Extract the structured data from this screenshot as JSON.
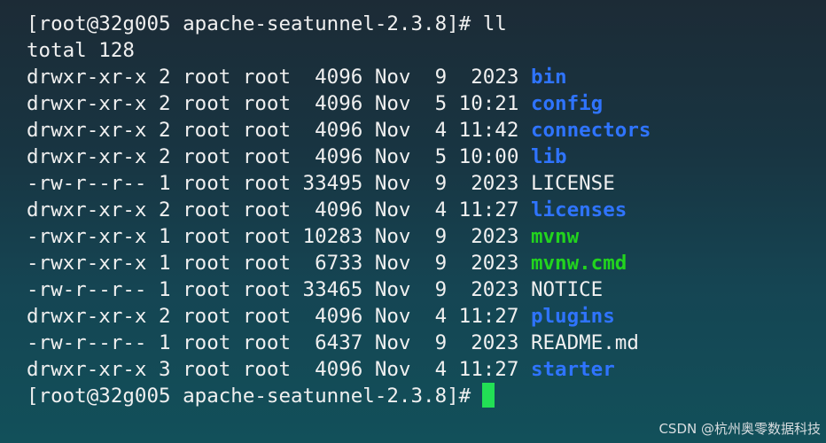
{
  "prompt": "[root@32g005 apache-seatunnel-2.3.8]#",
  "command": "ll",
  "total_line": "total 128",
  "entries": [
    {
      "meta": "drwxr-xr-x 2 root root  4096 Nov  9  2023",
      "name": "bin",
      "kind": "dir"
    },
    {
      "meta": "drwxr-xr-x 2 root root  4096 Nov  5 10:21",
      "name": "config",
      "kind": "dir"
    },
    {
      "meta": "drwxr-xr-x 2 root root  4096 Nov  4 11:42",
      "name": "connectors",
      "kind": "dir"
    },
    {
      "meta": "drwxr-xr-x 2 root root  4096 Nov  5 10:00",
      "name": "lib",
      "kind": "dir"
    },
    {
      "meta": "-rw-r--r-- 1 root root 33495 Nov  9  2023",
      "name": "LICENSE",
      "kind": "file"
    },
    {
      "meta": "drwxr-xr-x 2 root root  4096 Nov  4 11:27",
      "name": "licenses",
      "kind": "dir"
    },
    {
      "meta": "-rwxr-xr-x 1 root root 10283 Nov  9  2023",
      "name": "mvnw",
      "kind": "exe"
    },
    {
      "meta": "-rwxr-xr-x 1 root root  6733 Nov  9  2023",
      "name": "mvnw.cmd",
      "kind": "exe"
    },
    {
      "meta": "-rw-r--r-- 1 root root 33465 Nov  9  2023",
      "name": "NOTICE",
      "kind": "file"
    },
    {
      "meta": "drwxr-xr-x 2 root root  4096 Nov  4 11:27",
      "name": "plugins",
      "kind": "dir"
    },
    {
      "meta": "-rw-r--r-- 1 root root  6437 Nov  9  2023",
      "name": "README.md",
      "kind": "file"
    },
    {
      "meta": "drwxr-xr-x 3 root root  4096 Nov  4 11:27",
      "name": "starter",
      "kind": "dir"
    }
  ],
  "colors": {
    "dir": "#2f74ff",
    "exe": "#22d41e",
    "file": "#f0f0f0",
    "cursor": "#22e055"
  },
  "watermark": "CSDN @杭州奥零数据科技"
}
